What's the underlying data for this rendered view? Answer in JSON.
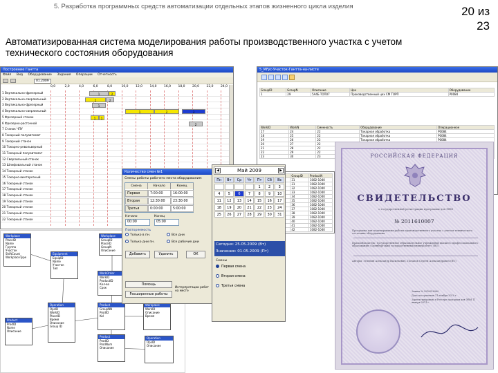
{
  "slide": {
    "header": "5. Разработка программных средств автоматизации отдельных этапов жизненного цикла изделия",
    "page_num": "20 из",
    "page_total": "23",
    "title": "Автоматизированная система моделирования работы производственного участка с учетом технического состояния оборудования"
  },
  "gantt": {
    "window_title": "Построение Гантта",
    "menu": [
      "Файл",
      "Вид",
      "Оборудование",
      "Задания",
      "Операции",
      "Отчетность"
    ],
    "toolbar_date": "01.2009",
    "ticks": [
      "0,0",
      "2,0",
      "4,0",
      "6,0",
      "8,0",
      "10,0",
      "12,0",
      "14,0",
      "16,0",
      "18,0",
      "20,0",
      "22,0",
      "24,0"
    ],
    "rows": [
      "1 Вертикально-фрезерный",
      "2 Вертикально-сверлильный",
      "3 Вертикально-фрезерный",
      "4 Вертикально-сверлильный",
      "5 Фрезерный станок",
      "6 Фрезерно-расточной",
      "7 Станок ЧПУ",
      "8 Токарный полуавтомат",
      "9 Токарный станок",
      "10 Токарно-револьверный",
      "11 Токарный полуавтомат",
      "12 Сверлильный станок",
      "13 Шлифовальный станок",
      "14 Токарный станок",
      "15 Токарно-винторезный",
      "16 Токарный станок",
      "17 Токарный станок",
      "18 Токарный станок",
      "19 Токарный станок",
      "20 Токарный станок",
      "21 Токарный станок",
      "22 Токарный станок"
    ],
    "bar_labels": [
      "1",
      "2",
      "1",
      "2",
      "1",
      "1",
      "2",
      "3",
      "1",
      "1",
      "2"
    ]
  },
  "tables": {
    "window_title": "5_MFyc-Участок-Гантта-на-листе",
    "top_headers": [
      "GroupID",
      "GroupN",
      "Описание",
      "Цех",
      "Оборудование"
    ],
    "top_rows": [
      [
        "1",
        "29",
        "5A4Б ТОП07",
        "Производственный цех СМ ТОРП",
        "Р0084"
      ]
    ],
    "mid_headers": [
      "WorkID",
      "WorkN",
      "Сменность",
      "Оборудование",
      "Операционное"
    ],
    "mid_rows": [
      [
        "17",
        "24",
        "22",
        "Токарная обработка",
        "Р0084"
      ],
      [
        "18",
        "25",
        "22",
        "Токарная обработка",
        "Р0084"
      ],
      [
        "19",
        "26",
        "22",
        "Токарная обработка",
        "Р0084"
      ],
      [
        "20",
        "27",
        "22",
        "Токарная обработка",
        "Р0084"
      ],
      [
        "21",
        "28",
        "22",
        "Токарная обработка",
        "Р0084"
      ],
      [
        "22",
        "29",
        "22",
        "Токарная обработка",
        "Р0084"
      ],
      [
        "23",
        "30",
        "23",
        "Токарная обработка",
        "Р0084"
      ]
    ]
  },
  "ops": {
    "headers": [
      "WorkID",
      "OpsID",
      "GroupID",
      "ProductN"
    ],
    "rows": [
      [
        "34",
        "39",
        "31",
        "1082-1040"
      ],
      [
        "35",
        "40",
        "31",
        "1082-1040"
      ],
      [
        "36",
        "41",
        "32",
        "1082-1040"
      ],
      [
        "37",
        "42",
        "33",
        "1082-1040"
      ],
      [
        "38",
        "43",
        "34",
        "1082-1040"
      ],
      [
        "39",
        "44",
        "35",
        "1082-1040"
      ],
      [
        "40",
        "45",
        "36",
        "1082-1040"
      ],
      [
        "41",
        "46",
        "37",
        "1082-1040"
      ],
      [
        "42",
        "47",
        "38",
        "1082-1040"
      ],
      [
        "43",
        "48",
        "39",
        "1082-1040"
      ],
      [
        "44",
        "49",
        "40",
        "1082-1040"
      ],
      [
        "45",
        "50",
        "41",
        "1082-1040"
      ],
      [
        "46",
        "51",
        "42",
        "1082-1040"
      ]
    ]
  },
  "dialog": {
    "title": "Количество смен №1",
    "group_label": "Смены работы рабочего места оборудования:",
    "col_headers": [
      "Смена",
      "Начало",
      "Конец"
    ],
    "rows": [
      [
        "Первая",
        "7:00:00",
        "16:00:00"
      ],
      [
        "Вторая",
        "12:30:00",
        "23:30:00"
      ],
      [
        "Третья",
        "0:00:00",
        "5:00:00"
      ]
    ],
    "start_label": "Начало",
    "end_label": "Конец",
    "start_value": "00:00",
    "end_value": "05:00",
    "repeat_label": "Повторяемость",
    "options": [
      "Только в пн.",
      "Все дни",
      "Только дни пн.",
      "Все рабочие дни"
    ],
    "buttons": [
      "Добавить",
      "Удалить",
      "ОК"
    ],
    "bottom_buttons": [
      "Помощь",
      "Расширенные работы"
    ],
    "side_note": "Интерпретации работ на месте"
  },
  "calendar": {
    "month": "Май 2009",
    "weekdays": [
      "Пн",
      "Вт",
      "Ср",
      "Чт",
      "Пт",
      "Сб",
      "Вс"
    ],
    "days": [
      "",
      "",
      "",
      "",
      "1",
      "2",
      "3",
      "4",
      "5",
      "6",
      "7",
      "8",
      "9",
      "10",
      "11",
      "12",
      "13",
      "14",
      "15",
      "16",
      "17",
      "18",
      "19",
      "20",
      "21",
      "22",
      "23",
      "24",
      "25",
      "26",
      "27",
      "28",
      "29",
      "30",
      "31"
    ],
    "today": "Сегодня: 25.05.2009 (Вт)",
    "selected": "Значение: 01.05.2009 (Пт)",
    "shift_label": "Смены",
    "shifts": [
      "Первая смена",
      "Вторая смена",
      "Третья смена"
    ]
  },
  "er": {
    "entities": [
      {
        "title": "Workplace",
        "fields": [
          "PlaceID",
          "Name",
          "Группа",
          "Участок",
          "ShiftCount",
          "WorkplaceType"
        ]
      },
      {
        "title": "Workplace",
        "fields": [
          "GroupID",
          "PlaceID",
          "GroupN",
          "Описание"
        ]
      },
      {
        "title": "WorkOrder",
        "fields": [
          "WorkID",
          "ProductID",
          "Кол-во",
          "Срок"
        ]
      },
      {
        "title": "Operation",
        "fields": [
          "OpsID",
          "WorkID",
          "PlaceID",
          "Время",
          "Описание",
          "Group ID"
        ]
      },
      {
        "title": "Product",
        "fields": [
          "ProdID",
          "Name",
          "Описание"
        ]
      },
      {
        "title": "Product",
        "fields": [
          "GroupNN",
          "ProdID",
          "Kol"
        ]
      },
      {
        "title": "Equipment",
        "fields": [
          "EquipID",
          "Name",
          "Участок",
          "Тип"
        ]
      },
      {
        "title": "Workplace",
        "fields": [
          "WorkID",
          "Описание",
          "Время"
        ]
      },
      {
        "title": "Product",
        "fields": [
          "ProdID",
          "ProdNum",
          "Описание"
        ]
      },
      {
        "title": "Operation",
        "fields": [
          "OpsID",
          "Описание"
        ]
      },
      {
        "title": "Worker",
        "fields": [
          "WorkerID",
          "FIO",
          "Разряд"
        ]
      }
    ]
  },
  "certificate": {
    "top": "РОССИЙСКАЯ ФЕДЕРАЦИЯ",
    "word": "СВИДЕТЕЛЬСТВО",
    "sub": "о государственной регистрации программы для ЭВМ",
    "number": "№ 2011610007",
    "text1": "Программа для моделирования работы производственного участка с учетом технического состояния оборудования",
    "text2": "Правообладатель: Государственное образовательное учреждение высшего профессионального образования «Оренбургский государственный университет» (RU)",
    "text3": "Авторы: Зелепин Александр Васильевич, Потапов Сергей Александрович (RU)",
    "text4": "Заявка № 2010616960",
    "text5": "Дата поступления 11 ноября 2010 г.",
    "text6": "Зарегистрировано в Реестре программ для ЭВМ 11 января 2011 г."
  }
}
